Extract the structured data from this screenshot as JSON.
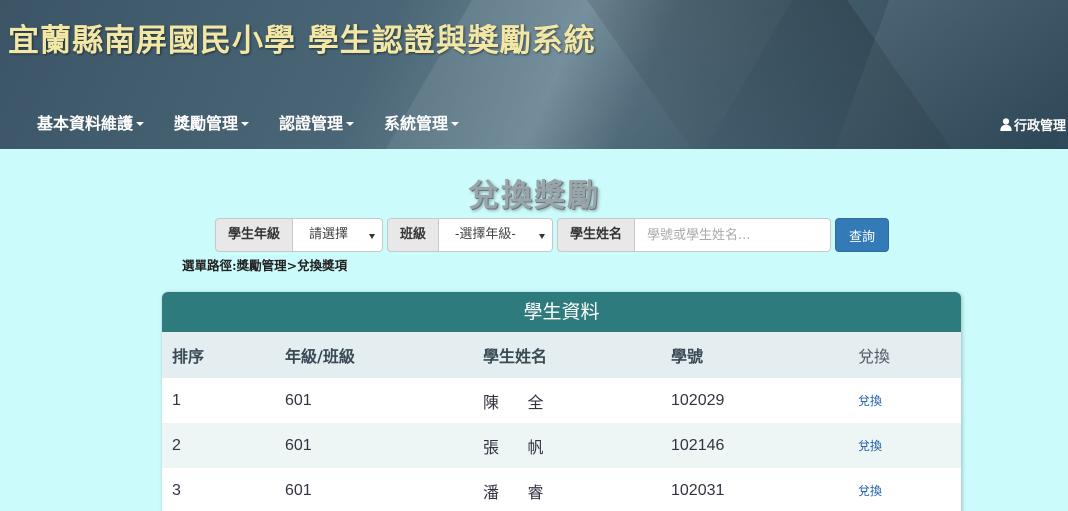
{
  "header": {
    "title": "宜蘭縣南屏國民小學  學生認證與獎勵系統",
    "nav": [
      {
        "label": "基本資料維護"
      },
      {
        "label": "獎勵管理"
      },
      {
        "label": "認證管理"
      },
      {
        "label": "系統管理"
      }
    ],
    "user": {
      "label": "行政管理",
      "icon": "user-icon"
    }
  },
  "page": {
    "title": "兌換獎勵"
  },
  "filter": {
    "grade_label": "學生年級",
    "grade_value": "請選擇",
    "class_label": "班級",
    "class_value": "-選擇年級-",
    "name_label": "學生姓名",
    "name_placeholder": "學號或學生姓名...",
    "search_label": "查詢"
  },
  "breadcrumb": "選單路徑:獎勵管理>兌換獎項",
  "panel": {
    "heading": "學生資料",
    "columns": [
      "排序",
      "年級/班級",
      "學生姓名",
      "學號",
      "兌換"
    ],
    "rows": [
      {
        "rank": "1",
        "class": "601",
        "name": "陳 全",
        "id": "102029",
        "action": "兌換"
      },
      {
        "rank": "2",
        "class": "601",
        "name": "張 帆",
        "id": "102146",
        "action": "兌換"
      },
      {
        "rank": "3",
        "class": "601",
        "name": "潘 睿",
        "id": "102031",
        "action": "兌換"
      }
    ]
  },
  "colors": {
    "header_title": "#f3e7a5",
    "panel_heading": "#2e7b7d",
    "background": "#ccfbfb",
    "button": "#337ab7"
  }
}
